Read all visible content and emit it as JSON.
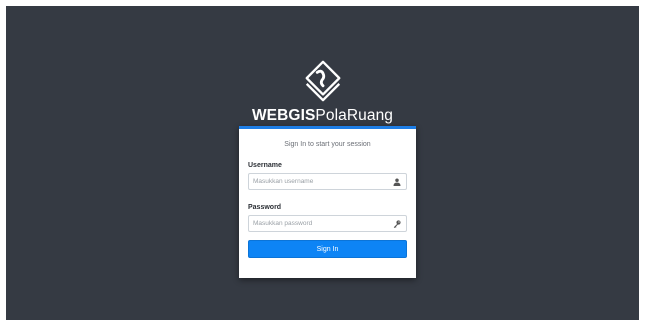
{
  "brand": {
    "title_bold": "WEBGIS",
    "title_rest": "PolaRuang",
    "logo_icon": "layers-diamond-logo-icon"
  },
  "login": {
    "message": "Sign In to start your session",
    "username_label": "Username",
    "username_placeholder": "Masukkan username",
    "username_icon": "user-icon",
    "password_label": "Password",
    "password_placeholder": "Masukkan password",
    "password_icon": "key-icon",
    "submit_label": "Sign In"
  },
  "colors": {
    "background": "#353a43",
    "accent": "#1e7ee6",
    "button": "#0d84f5"
  }
}
